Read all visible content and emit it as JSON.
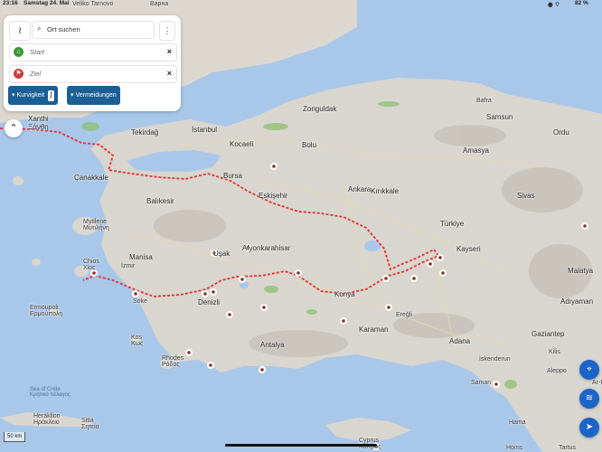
{
  "status": {
    "time": "23:16",
    "date": "Samstag 24. Mai",
    "battery": "82 %",
    "top_labels": [
      "Veliko Tarnovo",
      "Варна"
    ]
  },
  "search": {
    "placeholder": "Ort suchen"
  },
  "route": {
    "start_placeholder": "Start",
    "dest_placeholder": "Ziel"
  },
  "chips": {
    "curviness": "Kurvigkeit",
    "avoid": "Vermeidungen"
  },
  "scale": {
    "label": "50 km"
  },
  "colors": {
    "route": "#e53030",
    "panel_button": "#1b5f95",
    "fab": "#1b64c8",
    "sea": "#a9c7e8",
    "land": "#d9d6cf"
  },
  "places": [
    {
      "name": "Xanthi",
      "sub": "Ξάνθη"
    },
    {
      "name": "Tekirdağ"
    },
    {
      "name": "İstanbul"
    },
    {
      "name": "Kocaeli"
    },
    {
      "name": "Zonguldak"
    },
    {
      "name": "Bafra"
    },
    {
      "name": "Samsun"
    },
    {
      "name": "Ordu"
    },
    {
      "name": "Bolu"
    },
    {
      "name": "Amasya"
    },
    {
      "name": "Çanakkale"
    },
    {
      "name": "Bursa"
    },
    {
      "name": "Eskişehir"
    },
    {
      "name": "Ankara"
    },
    {
      "name": "Kırıkkale"
    },
    {
      "name": "Sivas"
    },
    {
      "name": "Balıkesir"
    },
    {
      "name": "Türkiye"
    },
    {
      "name": "Mytilene",
      "sub": "Μυτιλήνη"
    },
    {
      "name": "Kayseri"
    },
    {
      "name": "Manisa"
    },
    {
      "name": "Afyonkarahisar"
    },
    {
      "name": "Malatya"
    },
    {
      "name": "İzmir"
    },
    {
      "name": "Uşak"
    },
    {
      "name": "Chios",
      "sub": "Χίος"
    },
    {
      "name": "Söke"
    },
    {
      "name": "Denizli"
    },
    {
      "name": "Konya"
    },
    {
      "name": "Adıyaman"
    },
    {
      "name": "Ereğli"
    },
    {
      "name": "Ermoupoli",
      "sub": "Ερμούπολη"
    },
    {
      "name": "Karaman"
    },
    {
      "name": "Gaziantep"
    },
    {
      "name": "Adana"
    },
    {
      "name": "Kos",
      "sub": "Κως"
    },
    {
      "name": "Kilis"
    },
    {
      "name": "Antalya"
    },
    {
      "name": "Rhodes",
      "sub": "Ρόδος"
    },
    {
      "name": "İskenderun"
    },
    {
      "name": "Aleppo"
    },
    {
      "name": "Sea of Crete",
      "sub": "Κρητικό πέλαγος"
    },
    {
      "name": "Heraklion",
      "sub": "Ηράκλειο"
    },
    {
      "name": "Sitia",
      "sub": "Σητεία"
    },
    {
      "name": "Saman"
    },
    {
      "name": "Hama"
    },
    {
      "name": "Ar-R"
    },
    {
      "name": "Cyprus",
      "sub": "Κύπρος"
    },
    {
      "name": "Homs"
    },
    {
      "name": "Tartus"
    }
  ]
}
